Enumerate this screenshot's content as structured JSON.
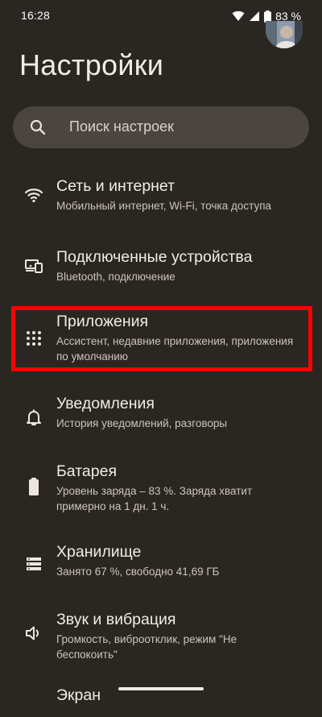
{
  "status_bar": {
    "time": "16:28",
    "battery_percent": "83 %"
  },
  "header": {
    "title": "Настройки"
  },
  "search": {
    "placeholder": "Поиск настроек"
  },
  "settings": [
    {
      "icon": "wifi-icon",
      "title": "Сеть и интернет",
      "subtitle": "Мобильный интернет, Wi-Fi, точка доступа"
    },
    {
      "icon": "connected-devices-icon",
      "title": "Подключенные устройства",
      "subtitle": "Bluetooth, подключение"
    },
    {
      "icon": "apps-grid-icon",
      "title": "Приложения",
      "subtitle": "Ассистент, недавние приложения, приложения по умолчанию"
    },
    {
      "icon": "bell-icon",
      "title": "Уведомления",
      "subtitle": "История уведомлений, разговоры"
    },
    {
      "icon": "battery-icon",
      "title": "Батарея",
      "subtitle": "Уровень заряда – 83 %. Заряда хватит примерно на 1 дн. 1 ч."
    },
    {
      "icon": "storage-icon",
      "title": "Хранилище",
      "subtitle": "Занято 67 %, свободно 41,69 ГБ"
    },
    {
      "icon": "speaker-icon",
      "title": "Звук и вибрация",
      "subtitle": "Громкость, виброотклик, режим \"Не беспокоить\""
    },
    {
      "icon": "display-icon",
      "title": "Экран",
      "subtitle": ""
    }
  ],
  "colors": {
    "background": "#2a2622",
    "search_background": "#4a4540",
    "highlight": "#ff0000"
  }
}
